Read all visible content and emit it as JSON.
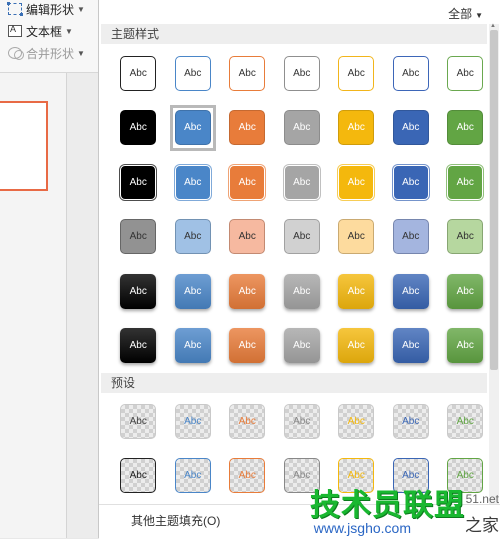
{
  "ribbon": {
    "edit_shape": "编辑形状",
    "text_box": "文本框",
    "merge_shapes": "合并形状"
  },
  "panel": {
    "filter": "全部",
    "section_theme": "主题样式",
    "section_preset": "预设",
    "footer_button": "其他主题填充(O)"
  },
  "tile_label": "Abc",
  "theme_rows": [
    {
      "style": "outline",
      "colors": [
        "#222222",
        "#4a86c8",
        "#e87c3a",
        "#8f8f8f",
        "#f2b51b",
        "#3d66b8",
        "#6aa84f"
      ]
    },
    {
      "style": "solid",
      "colors": [
        "#000000",
        "#4a86c8",
        "#e87c3a",
        "#a5a5a5",
        "#f4b80d",
        "#3a66b5",
        "#62a544"
      ]
    },
    {
      "style": "solid-light",
      "colors": [
        "#000000",
        "#4a86c8",
        "#e87c3a",
        "#a5a5a5",
        "#f4b80d",
        "#3a66b5",
        "#62a544"
      ]
    },
    {
      "style": "tint",
      "colors": [
        "#7f7f7f",
        "#8fb6e0",
        "#f4ad8f",
        "#c9c9c9",
        "#fdd58d",
        "#94a8d9",
        "#a9d08e"
      ]
    },
    {
      "style": "gradient",
      "colors": [
        "#000000",
        "#4a86c8",
        "#e87c3a",
        "#a5a5a5",
        "#f4b80d",
        "#3a66b5",
        "#62a544"
      ]
    },
    {
      "style": "gradient",
      "colors": [
        "#000000",
        "#4a86c8",
        "#e87c3a",
        "#a5a5a5",
        "#f4b80d",
        "#3a66b5",
        "#62a544"
      ]
    }
  ],
  "preset_rows": [
    {
      "style": "preset",
      "colors": [
        "#444444",
        "#4a86c8",
        "#e87c3a",
        "#888888",
        "#f4b80d",
        "#3a66b5",
        "#62a544"
      ]
    },
    {
      "style": "preset-outline",
      "colors": [
        "#222222",
        "#4a86c8",
        "#e87c3a",
        "#888888",
        "#f4b80d",
        "#3a66b5",
        "#62a544"
      ]
    }
  ],
  "selected": {
    "row": 1,
    "col": 1
  },
  "watermark": {
    "brand": "技术员联盟",
    "url": "www.jsgho.com",
    "site": "51.net",
    "sub": "之家"
  }
}
